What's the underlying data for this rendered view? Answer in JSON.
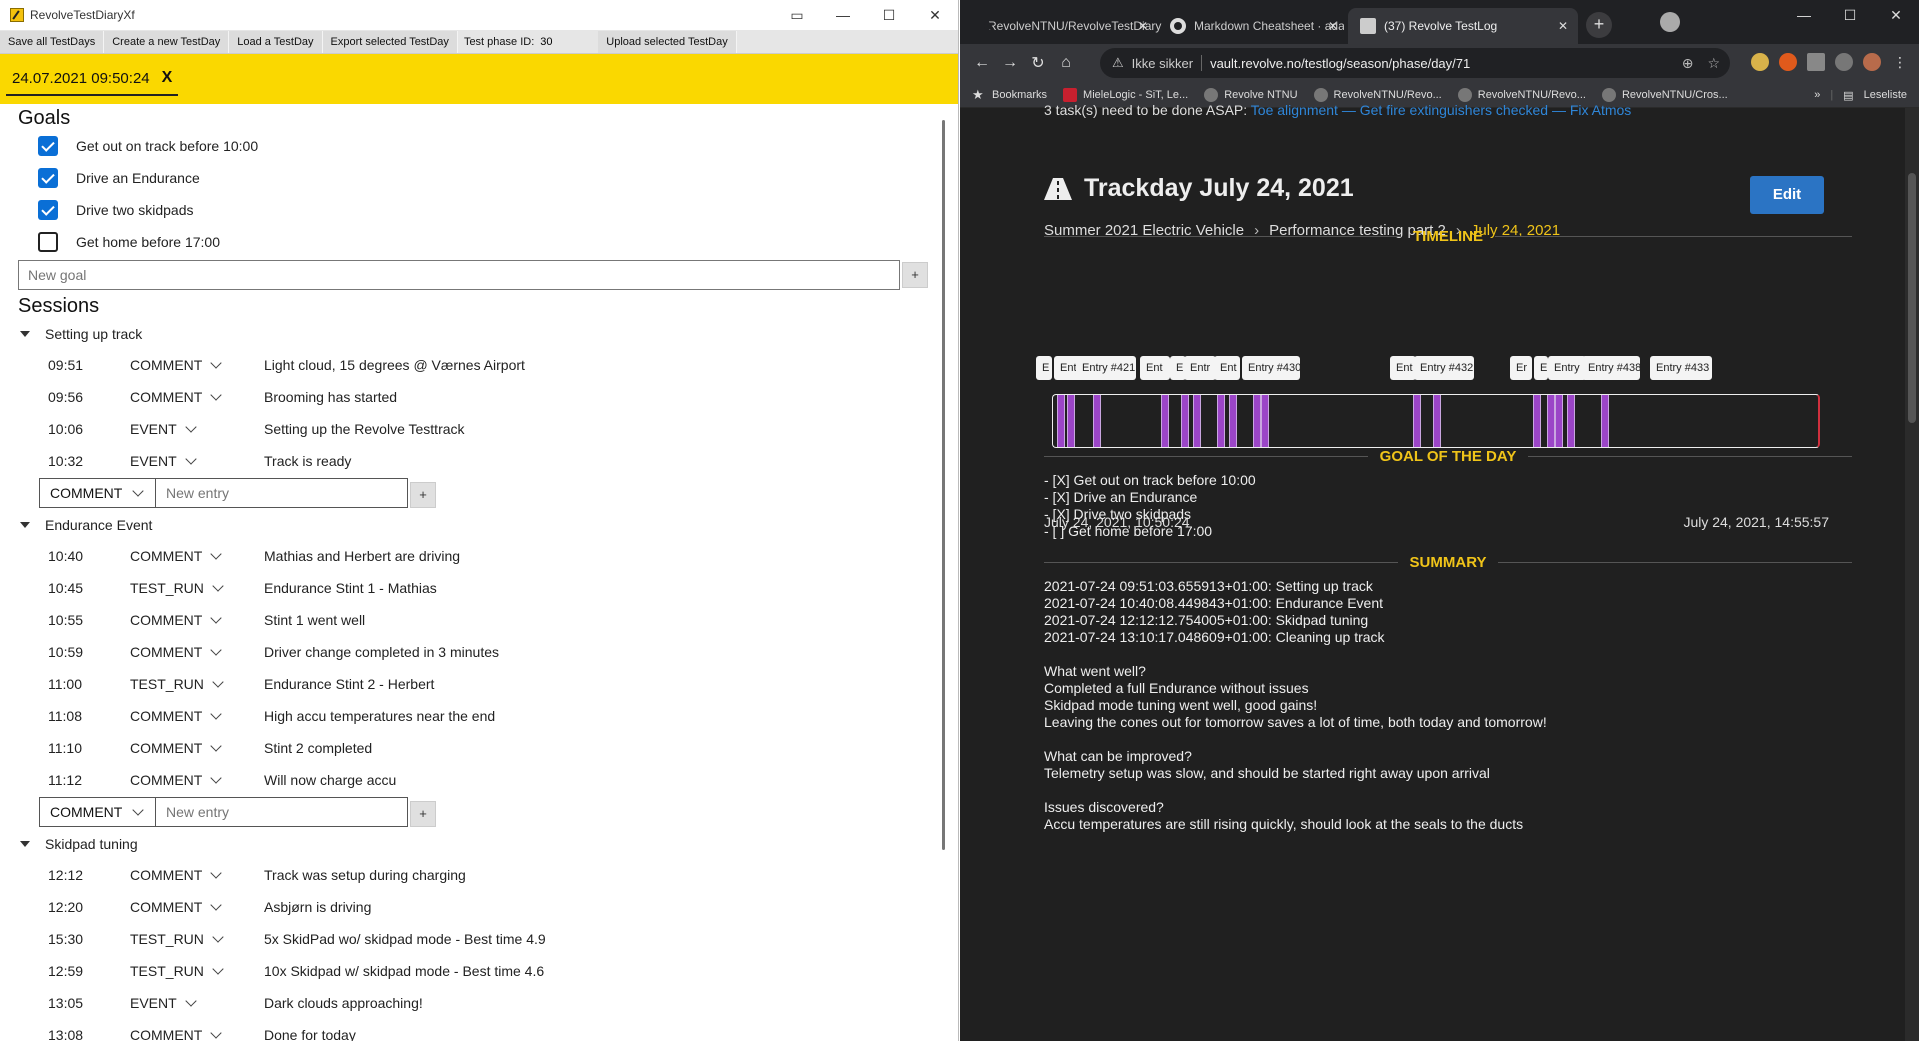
{
  "left_app": {
    "window_title": "RevolveTestDiaryXf",
    "toolbar": {
      "save_all": "Save all TestDays",
      "create_new": "Create a new TestDay",
      "load": "Load a TestDay",
      "export": "Export selected TestDay",
      "phase_label": "Test phase ID:",
      "phase_value": "30",
      "upload": "Upload selected TestDay"
    },
    "tab": {
      "label": "24.07.2021 09:50:24",
      "close": "X"
    },
    "goals": {
      "heading": "Goals",
      "items": [
        {
          "label": "Get out on track before 10:00",
          "checked": true
        },
        {
          "label": "Drive an Endurance",
          "checked": true
        },
        {
          "label": "Drive two skidpads",
          "checked": true
        },
        {
          "label": "Get home before 17:00",
          "checked": false
        }
      ],
      "new_placeholder": "New goal",
      "add": "+"
    },
    "sessions": {
      "heading": "Sessions",
      "new_entry_type": "COMMENT",
      "new_entry_placeholder": "New entry",
      "add": "+",
      "list": [
        {
          "name": "Setting up track",
          "entries": [
            {
              "time": "09:51",
              "type": "COMMENT",
              "text": "Light cloud, 15 degrees @ Værnes Airport"
            },
            {
              "time": "09:56",
              "type": "COMMENT",
              "text": "Brooming has started"
            },
            {
              "time": "10:06",
              "type": "EVENT",
              "text": "Setting up the Revolve Testtrack"
            },
            {
              "time": "10:32",
              "type": "EVENT",
              "text": "Track is ready"
            }
          ]
        },
        {
          "name": "Endurance Event",
          "entries": [
            {
              "time": "10:40",
              "type": "COMMENT",
              "text": "Mathias and Herbert are driving"
            },
            {
              "time": "10:45",
              "type": "TEST_RUN",
              "text": "Endurance Stint 1 - Mathias"
            },
            {
              "time": "10:55",
              "type": "COMMENT",
              "text": "Stint 1 went well"
            },
            {
              "time": "10:59",
              "type": "COMMENT",
              "text": "Driver change completed in 3 minutes"
            },
            {
              "time": "11:00",
              "type": "TEST_RUN",
              "text": "Endurance Stint 2 - Herbert"
            },
            {
              "time": "11:08",
              "type": "COMMENT",
              "text": "High accu temperatures near the end"
            },
            {
              "time": "11:10",
              "type": "COMMENT",
              "text": "Stint 2 completed"
            },
            {
              "time": "11:12",
              "type": "COMMENT",
              "text": "Will now charge accu"
            }
          ]
        },
        {
          "name": "Skidpad tuning",
          "entries": [
            {
              "time": "12:12",
              "type": "COMMENT",
              "text": "Track was setup during charging"
            },
            {
              "time": "12:20",
              "type": "COMMENT",
              "text": "Asbjørn is driving"
            },
            {
              "time": "15:30",
              "type": "TEST_RUN",
              "text": "5x SkidPad wo/ skidpad mode - Best time 4.9"
            },
            {
              "time": "12:59",
              "type": "TEST_RUN",
              "text": "10x Skidpad w/ skidpad mode - Best time 4.6"
            },
            {
              "time": "13:05",
              "type": "EVENT",
              "text": "Dark clouds approaching!"
            },
            {
              "time": "13:08",
              "type": "COMMENT",
              "text": "Done for today"
            }
          ]
        }
      ]
    }
  },
  "browser": {
    "tabs": [
      {
        "label": "RevolveNTNU/RevolveTestDiary"
      },
      {
        "label": "Markdown Cheatsheet · adam-p"
      },
      {
        "label": "(37) Revolve TestLog"
      }
    ],
    "address": {
      "security": "Ikke sikker",
      "url": "vault.revolve.no/testlog/season/phase/day/71"
    },
    "bookmarks": [
      "Bookmarks",
      "MieleLogic - SiT, Le...",
      "Revolve NTNU",
      "RevolveNTNU/Revo...",
      "RevolveNTNU/Revo...",
      "RevolveNTNU/Cros..."
    ],
    "bookmarks_more": "»",
    "reading_list": "Leseliste",
    "page": {
      "asap_prefix": "3 task(s) need to be done ASAP:",
      "asap_tasks": [
        "Toe alignment",
        "Get fire extinguishers checked",
        "Fix Atmos"
      ],
      "asap_sep": "—",
      "title": "Trackday July 24, 2021",
      "edit": "Edit",
      "breadcrumb": [
        "Summer 2021 Electric Vehicle",
        "Performance testing part 2",
        "July 24, 2021"
      ],
      "timeline_heading": "TIMELINE",
      "timeline_labels": [
        "E",
        "Entr",
        "Entry #421",
        "Ent",
        "E",
        "Entr",
        "Ent",
        "Entry #430",
        "Ent",
        "Entry #432",
        "Er",
        "E",
        "Entry",
        "Entry #438",
        "Entry #433"
      ],
      "timeline_start": "July 24, 2021, 10:50:24",
      "timeline_end": "July 24, 2021, 14:55:57",
      "goal_heading": "GOAL OF THE DAY",
      "goal_lines": [
        "- [X] Get out on track before 10:00",
        "- [X] Drive an Endurance",
        "- [X] Drive two skidpads",
        "- [ ] Get home before 17:00"
      ],
      "summary_heading": "SUMMARY",
      "summary_lines": [
        "2021-07-24 09:51:03.655913+01:00: Setting up track",
        "2021-07-24 10:40:08.449843+01:00: Endurance Event",
        "2021-07-24 12:12:12.754005+01:00: Skidpad tuning",
        "2021-07-24 13:10:17.048609+01:00: Cleaning up track",
        "",
        "What went well?",
        "Completed a full Endurance without issues",
        "Skidpad mode tuning went well, good gains!",
        "Leaving the cones out for tomorrow saves a lot of time, both today and tomorrow!",
        "",
        "What can be improved?",
        "Telemetry setup was slow, and should be started right away upon arrival",
        "",
        "Issues discovered?",
        "Accu temperatures are still rising quickly, should look at the seals to the ducts"
      ]
    }
  },
  "colors": {
    "tab_yellow": "#fad800",
    "checkbox_blue": "#0a6fd6",
    "timeline_purple": "#9b45c7",
    "heading_yellow": "#f0c419",
    "edit_blue": "#2b74c4",
    "link_blue": "#2f86d8"
  }
}
